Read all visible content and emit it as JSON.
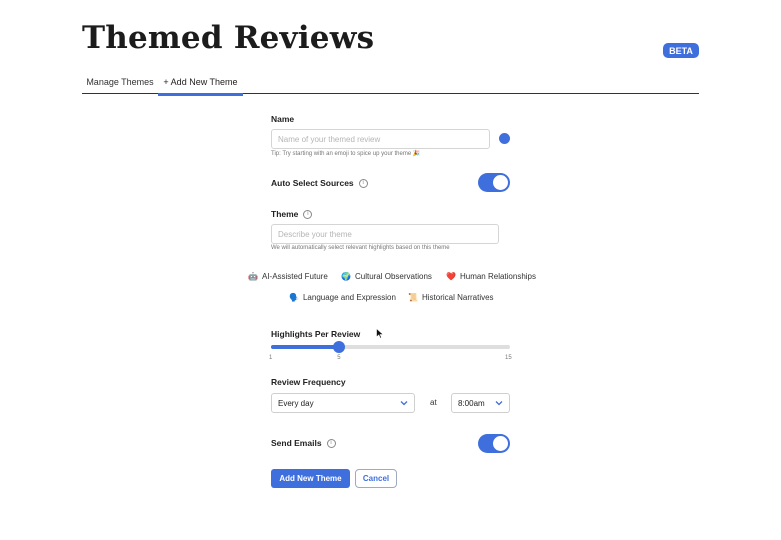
{
  "header": {
    "title": "Themed Reviews",
    "badge": "BETA"
  },
  "tabs": [
    {
      "label": "Manage Themes"
    },
    {
      "label": "+ Add New Theme",
      "active": true
    }
  ],
  "form": {
    "name": {
      "label": "Name",
      "placeholder": "Name of your themed review",
      "hint": "Tip: Try starting with an emoji to spice up your theme 🎉"
    },
    "auto_select": {
      "label": "Auto Select Sources",
      "enabled": true
    },
    "theme": {
      "label": "Theme",
      "placeholder": "Describe your theme",
      "hint": "We will automatically select relevant highlights based on this theme"
    },
    "suggestions": [
      {
        "emoji": "🤖",
        "label": "AI-Assisted Future"
      },
      {
        "emoji": "🌍",
        "label": "Cultural Observations"
      },
      {
        "emoji": "❤️",
        "label": "Human Relationships"
      },
      {
        "emoji": "🗣️",
        "label": "Language and Expression"
      },
      {
        "emoji": "📜",
        "label": "Historical Narratives"
      }
    ],
    "highlights": {
      "label": "Highlights Per Review",
      "min": "1",
      "value": "5",
      "max": "15"
    },
    "frequency": {
      "label": "Review Frequency",
      "value": "Every day",
      "at_label": "at",
      "time": "8:00am"
    },
    "send_emails": {
      "label": "Send Emails",
      "enabled": true
    },
    "actions": {
      "submit": "Add New Theme",
      "cancel": "Cancel"
    }
  },
  "colors": {
    "accent": "#3f6fdc",
    "text": "#1f1f1f",
    "muted": "#777777"
  }
}
